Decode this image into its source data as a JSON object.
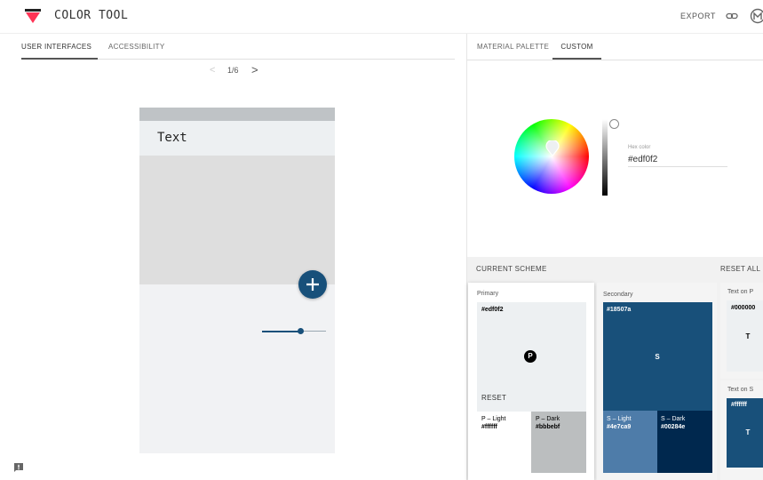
{
  "header": {
    "title": "COLOR TOOL",
    "export_label": "EXPORT",
    "icons": [
      "link-icon",
      "material-icon"
    ]
  },
  "left_tabs": [
    "USER INTERFACES",
    "ACCESSIBILITY"
  ],
  "pager": {
    "text": "1/6",
    "prev": "<",
    "next": ">"
  },
  "preview": {
    "appbar_text": "Text",
    "fab_symbol": "+",
    "slider_value": 0.6
  },
  "right_tabs": [
    "MATERIAL PALETTE",
    "CUSTOM"
  ],
  "picker": {
    "hex_label": "Hex color",
    "hex_value": "#edf0f2"
  },
  "scheme": {
    "title": "CURRENT SCHEME",
    "reset_all": "RESET ALL",
    "primary": {
      "label": "Primary",
      "hex": "#edf0f2",
      "badge": "P",
      "reset": "RESET",
      "light": {
        "label": "P – Light",
        "hex": "#ffffff"
      },
      "dark": {
        "label": "P – Dark",
        "hex": "#bbbebf"
      }
    },
    "secondary": {
      "label": "Secondary",
      "hex": "#18507a",
      "badge": "S",
      "light": {
        "label": "S – Light",
        "hex": "#4e7ca9"
      },
      "dark": {
        "label": "S – Dark",
        "hex": "#00284e"
      }
    },
    "text_on_p": {
      "label": "Text on P",
      "hex": "#000000",
      "badge": "T"
    },
    "text_on_s": {
      "label": "Text on S",
      "hex": "#ffffff",
      "badge": "T"
    }
  },
  "colors": {
    "primary": "#edf0f2",
    "primary_light": "#ffffff",
    "primary_dark": "#bbbebf",
    "secondary": "#18507a",
    "secondary_light": "#4e7ca9",
    "secondary_dark": "#00284e"
  }
}
